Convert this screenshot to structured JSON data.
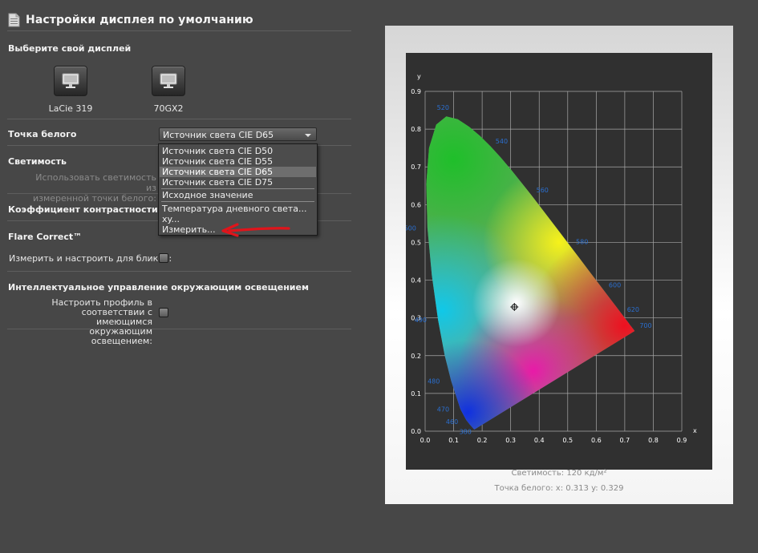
{
  "window": {
    "title": "Настройки дисплея по умолчанию"
  },
  "display_section": {
    "title": "Выберите свой дисплей",
    "displays": [
      {
        "label": "LaCie 319",
        "icon": "monitor-icon"
      },
      {
        "label": "70GX2",
        "icon": "monitor-icon"
      }
    ]
  },
  "white_point": {
    "label": "Точка белого",
    "selected": "Источник света CIE D65",
    "options": [
      "Источник света CIE D50",
      "Источник света CIE D55",
      "Источник света CIE D65",
      "Источник света CIE D75",
      "Исходное значение",
      "Температура дневного света...",
      "xy...",
      "Измерить..."
    ]
  },
  "luminance": {
    "title": "Светимость",
    "option_line1": "Использовать светимость из",
    "option_line2": "измеренной точки белого:"
  },
  "contrast": {
    "title": "Коэффициент контрастности"
  },
  "flare": {
    "title": "Flare Correct™",
    "option": "Измерить и настроить для бликов:"
  },
  "ambient": {
    "title": "Интеллектуальное управление окружающим освещением",
    "option_line1": "Настроить профиль в",
    "option_line2": "соответствии с имеющимся",
    "option_line3": "окружающим освещением:"
  },
  "chart_info": {
    "luminance_label": "Светимость:",
    "luminance_value": "120 кд/м²",
    "whitepoint_label": "Точка белого:",
    "whitepoint_x": "x: 0.313",
    "whitepoint_y": "y: 0.329"
  },
  "chart_data": {
    "type": "scatter",
    "xlabel": "x",
    "ylabel": "y",
    "xlim": [
      0,
      0.9
    ],
    "ylim": [
      0,
      0.9
    ],
    "grid": true,
    "x_ticks": [
      "0.0",
      "0.1",
      "0.2",
      "0.3",
      "0.4",
      "0.5",
      "0.6",
      "0.7",
      "0.8",
      "0.9"
    ],
    "y_ticks": [
      "0.0",
      "0.1",
      "0.2",
      "0.3",
      "0.4",
      "0.5",
      "0.6",
      "0.7",
      "0.8",
      "0.9"
    ],
    "wavelength_labels": [
      {
        "text": "380",
        "x": 0.174,
        "y": 0.005
      },
      {
        "text": "460",
        "x": 0.144,
        "y": 0.03
      },
      {
        "text": "470",
        "x": 0.124,
        "y": 0.058
      },
      {
        "text": "480",
        "x": 0.091,
        "y": 0.133
      },
      {
        "text": "490",
        "x": 0.045,
        "y": 0.295
      },
      {
        "text": "500",
        "x": 0.008,
        "y": 0.538
      },
      {
        "text": "520",
        "x": 0.074,
        "y": 0.834
      },
      {
        "text": "540",
        "x": 0.23,
        "y": 0.754
      },
      {
        "text": "560",
        "x": 0.373,
        "y": 0.624
      },
      {
        "text": "580",
        "x": 0.512,
        "y": 0.487
      },
      {
        "text": "600",
        "x": 0.627,
        "y": 0.372
      },
      {
        "text": "620",
        "x": 0.691,
        "y": 0.308
      },
      {
        "text": "700",
        "x": 0.735,
        "y": 0.265
      }
    ],
    "white_point": {
      "x": 0.313,
      "y": 0.329
    }
  },
  "colors": {
    "background": "#474747",
    "chart_background": "#303030",
    "wavelength_label": "#2a6fd0",
    "arrow": "#e0141b"
  }
}
